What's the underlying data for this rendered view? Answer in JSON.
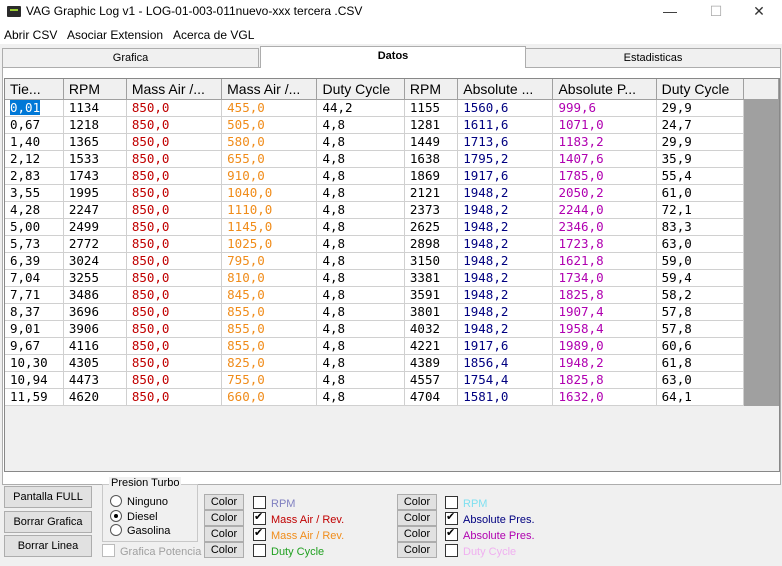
{
  "window": {
    "title": "VAG Graphic Log  v1 -  LOG-01-003-011nuevo-xxx tercera .CSV",
    "min_icon": "—",
    "max_icon": "☐",
    "close_icon": "✕"
  },
  "menu": [
    "Abrir CSV",
    "Asociar Extension",
    "Acerca de VGL"
  ],
  "tabs": [
    {
      "label": "Grafica"
    },
    {
      "label": "Datos",
      "active": true
    },
    {
      "label": "Estadisticas"
    }
  ],
  "table": {
    "headers": [
      "Tie...",
      "RPM",
      "Mass Air /...",
      "Mass Air /...",
      "Duty Cycle",
      "RPM",
      "Absolute ...",
      "Absolute P...",
      "Duty Cycle"
    ],
    "column_colors": [
      "#000000",
      "#000000",
      "#c00000",
      "#f08c1a",
      "#000000",
      "#000000",
      "#000080",
      "#b000b0",
      "#000000"
    ],
    "rows": [
      [
        "0,01",
        "1134",
        "850,0",
        "455,0",
        "44,2",
        "1155",
        "1560,6",
        "999,6",
        "29,9"
      ],
      [
        "0,67",
        "1218",
        "850,0",
        "505,0",
        "4,8",
        "1281",
        "1611,6",
        "1071,0",
        "24,7"
      ],
      [
        "1,40",
        "1365",
        "850,0",
        "580,0",
        "4,8",
        "1449",
        "1713,6",
        "1183,2",
        "29,9"
      ],
      [
        "2,12",
        "1533",
        "850,0",
        "655,0",
        "4,8",
        "1638",
        "1795,2",
        "1407,6",
        "35,9"
      ],
      [
        "2,83",
        "1743",
        "850,0",
        "910,0",
        "4,8",
        "1869",
        "1917,6",
        "1785,0",
        "55,4"
      ],
      [
        "3,55",
        "1995",
        "850,0",
        "1040,0",
        "4,8",
        "2121",
        "1948,2",
        "2050,2",
        "61,0"
      ],
      [
        "4,28",
        "2247",
        "850,0",
        "1110,0",
        "4,8",
        "2373",
        "1948,2",
        "2244,0",
        "72,1"
      ],
      [
        "5,00",
        "2499",
        "850,0",
        "1145,0",
        "4,8",
        "2625",
        "1948,2",
        "2346,0",
        "83,3"
      ],
      [
        "5,73",
        "2772",
        "850,0",
        "1025,0",
        "4,8",
        "2898",
        "1948,2",
        "1723,8",
        "63,0"
      ],
      [
        "6,39",
        "3024",
        "850,0",
        "795,0",
        "4,8",
        "3150",
        "1948,2",
        "1621,8",
        "59,0"
      ],
      [
        "7,04",
        "3255",
        "850,0",
        "810,0",
        "4,8",
        "3381",
        "1948,2",
        "1734,0",
        "59,4"
      ],
      [
        "7,71",
        "3486",
        "850,0",
        "845,0",
        "4,8",
        "3591",
        "1948,2",
        "1825,8",
        "58,2"
      ],
      [
        "8,37",
        "3696",
        "850,0",
        "855,0",
        "4,8",
        "3801",
        "1948,2",
        "1907,4",
        "57,8"
      ],
      [
        "9,01",
        "3906",
        "850,0",
        "855,0",
        "4,8",
        "4032",
        "1948,2",
        "1958,4",
        "57,8"
      ],
      [
        "9,67",
        "4116",
        "850,0",
        "855,0",
        "4,8",
        "4221",
        "1917,6",
        "1989,0",
        "60,6"
      ],
      [
        "10,30",
        "4305",
        "850,0",
        "825,0",
        "4,8",
        "4389",
        "1856,4",
        "1948,2",
        "61,8"
      ],
      [
        "10,94",
        "4473",
        "850,0",
        "755,0",
        "4,8",
        "4557",
        "1754,4",
        "1825,8",
        "63,0"
      ],
      [
        "11,59",
        "4620",
        "850,0",
        "660,0",
        "4,8",
        "4704",
        "1581,0",
        "1632,0",
        "64,1"
      ]
    ]
  },
  "buttons": {
    "full": "Pantalla  FULL",
    "clear_graph": "Borrar Grafica",
    "clear_line": "Borrar Linea"
  },
  "turbo": {
    "legend": "Presion Turbo",
    "options": [
      {
        "label": "Ninguno",
        "selected": false
      },
      {
        "label": "Diesel",
        "selected": true
      },
      {
        "label": "Gasolina",
        "selected": false
      }
    ]
  },
  "power_graph": {
    "label": "Grafica Potencia",
    "checked": false,
    "enabled": false
  },
  "color_label": "Color",
  "series_left": [
    {
      "label": "RPM",
      "checked": false,
      "color": "#8080c0"
    },
    {
      "label": "Mass Air / Rev.",
      "checked": true,
      "color": "#c00000"
    },
    {
      "label": "Mass Air / Rev.",
      "checked": true,
      "color": "#f08c1a"
    },
    {
      "label": "Duty Cycle",
      "checked": false,
      "color": "#20a020"
    }
  ],
  "series_right": [
    {
      "label": "RPM",
      "checked": false,
      "color": "#80e0f0"
    },
    {
      "label": "Absolute Pres.",
      "checked": true,
      "color": "#000080"
    },
    {
      "label": "Absolute Pres.",
      "checked": true,
      "color": "#b000b0"
    },
    {
      "label": "Duty Cycle",
      "checked": false,
      "color": "#f0b0f0"
    }
  ]
}
